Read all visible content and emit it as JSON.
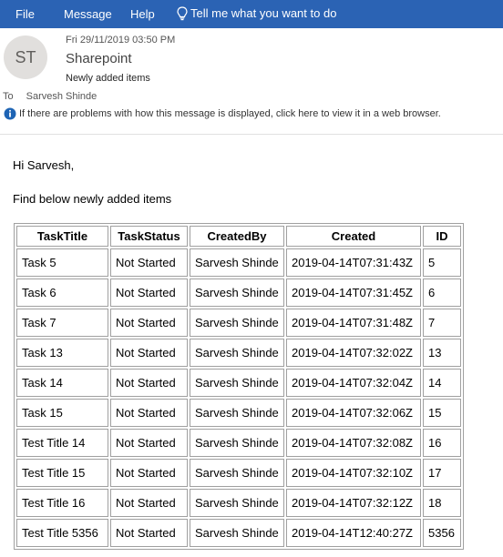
{
  "ribbon": {
    "tabs": [
      "File",
      "Message",
      "Help"
    ],
    "tell_me": "Tell me what you want to do",
    "icon": "lightbulb-icon",
    "color": "#2b63b4"
  },
  "header": {
    "avatar_initials": "ST",
    "date": "Fri 29/11/2019 03:50 PM",
    "sender": "Sharepoint",
    "subject": "Newly added items",
    "to_label": "To",
    "to_name": "Sarvesh Shinde",
    "info_text": "If there are problems with how this message is displayed, click here to view it in a web browser."
  },
  "body": {
    "greeting": "Hi Sarvesh,",
    "intro": "Find below newly added items",
    "table": {
      "headers": [
        "TaskTitle",
        "TaskStatus",
        "CreatedBy",
        "Created",
        "ID"
      ],
      "rows": [
        [
          "Task 5",
          "Not Started",
          "Sarvesh Shinde",
          "2019-04-14T07:31:43Z",
          "5"
        ],
        [
          "Task 6",
          "Not Started",
          "Sarvesh Shinde",
          "2019-04-14T07:31:45Z",
          "6"
        ],
        [
          "Task 7",
          "Not Started",
          "Sarvesh Shinde",
          "2019-04-14T07:31:48Z",
          "7"
        ],
        [
          "Task 13",
          "Not Started",
          "Sarvesh Shinde",
          "2019-04-14T07:32:02Z",
          "13"
        ],
        [
          "Task 14",
          "Not Started",
          "Sarvesh Shinde",
          "2019-04-14T07:32:04Z",
          "14"
        ],
        [
          "Task 15",
          "Not Started",
          "Sarvesh Shinde",
          "2019-04-14T07:32:06Z",
          "15"
        ],
        [
          "Test Title 14",
          "Not Started",
          "Sarvesh Shinde",
          "2019-04-14T07:32:08Z",
          "16"
        ],
        [
          "Test Title 15",
          "Not Started",
          "Sarvesh Shinde",
          "2019-04-14T07:32:10Z",
          "17"
        ],
        [
          "Test Title 16",
          "Not Started",
          "Sarvesh Shinde",
          "2019-04-14T07:32:12Z",
          "18"
        ],
        [
          "Test Title 5356",
          "Not Started",
          "Sarvesh Shinde",
          "2019-04-14T12:40:27Z",
          "5356"
        ]
      ]
    }
  }
}
